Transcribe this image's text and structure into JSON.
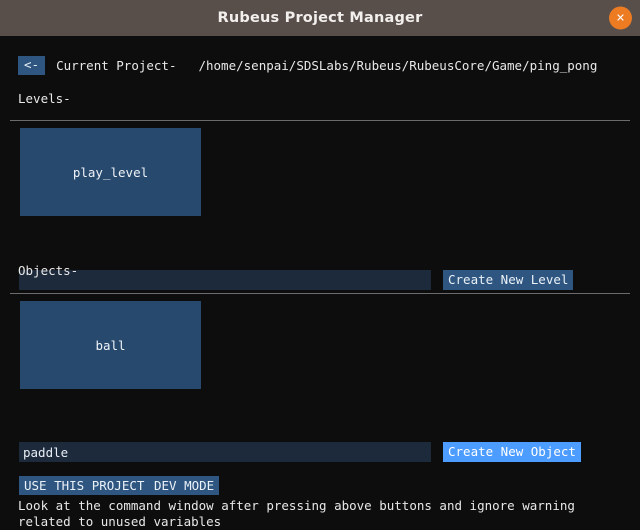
{
  "window": {
    "title": "Rubeus Project Manager",
    "close_icon": "close-icon",
    "close_glyph": "✕",
    "titlebar_color": "#584f4b",
    "close_color": "#ed7b22",
    "background_color": "#0d0d0d"
  },
  "project": {
    "back_label": "<-",
    "current_label": "Current Project-",
    "path": "/home/senpai/SDSLabs/Rubeus/RubeusCore/Game/ping_pong"
  },
  "levels": {
    "heading": "Levels-",
    "items": [
      {
        "label": "play_level"
      }
    ],
    "input_value": "",
    "input_placeholder": "",
    "create_label": "Create New Level",
    "create_color": "#2f5680"
  },
  "objects": {
    "heading": "Objects-",
    "items": [
      {
        "label": "ball"
      }
    ],
    "input_value": "paddle",
    "input_placeholder": "",
    "create_label": "Create New Object",
    "create_color": "#4d9cff"
  },
  "footer": {
    "use_project_label": "USE THIS PROJECT",
    "dev_mode_label": "DEV MODE",
    "note": "Look at the command window after pressing above buttons and ignore warning related to unused variables"
  },
  "colors": {
    "card": "#28496e",
    "input": "#1d2a3c",
    "button": "#2f5680",
    "button_hover": "#4d9cff",
    "rule": "#6b6b6b",
    "text": "#e8e8e8"
  }
}
